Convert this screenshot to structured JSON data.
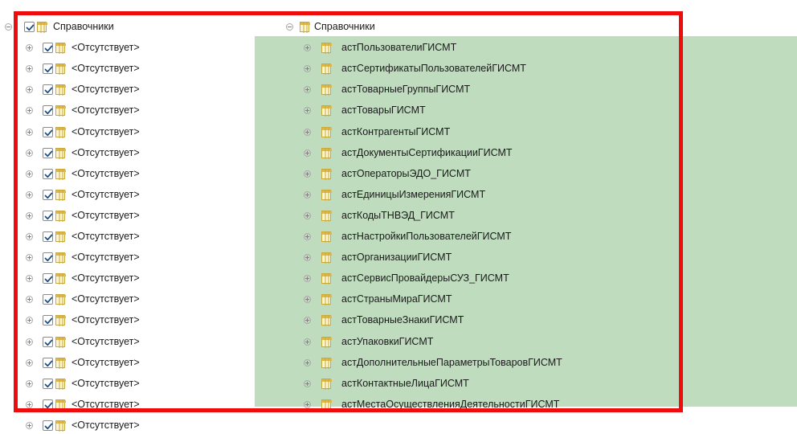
{
  "left_tree": {
    "root_label": "Справочники",
    "items": [
      {
        "label": "<Отсутствует>"
      },
      {
        "label": "<Отсутствует>"
      },
      {
        "label": "<Отсутствует>"
      },
      {
        "label": "<Отсутствует>"
      },
      {
        "label": "<Отсутствует>"
      },
      {
        "label": "<Отсутствует>"
      },
      {
        "label": "<Отсутствует>"
      },
      {
        "label": "<Отсутствует>"
      },
      {
        "label": "<Отсутствует>"
      },
      {
        "label": "<Отсутствует>"
      },
      {
        "label": "<Отсутствует>"
      },
      {
        "label": "<Отсутствует>"
      },
      {
        "label": "<Отсутствует>"
      },
      {
        "label": "<Отсутствует>"
      },
      {
        "label": "<Отсутствует>"
      },
      {
        "label": "<Отсутствует>"
      },
      {
        "label": "<Отсутствует>"
      },
      {
        "label": "<Отсутствует>"
      },
      {
        "label": "<Отсутствует>"
      }
    ]
  },
  "right_tree": {
    "root_label": "Справочники",
    "items": [
      {
        "label": "астПользователиГИСМТ"
      },
      {
        "label": "астСертификатыПользователейГИСМТ"
      },
      {
        "label": "астТоварныеГруппыГИСМТ"
      },
      {
        "label": "астТоварыГИСМТ"
      },
      {
        "label": "астКонтрагентыГИСМТ"
      },
      {
        "label": "астДокументыСертификацииГИСМТ"
      },
      {
        "label": "астОператорыЭДО_ГИСМТ"
      },
      {
        "label": "астЕдиницыИзмеренияГИСМТ"
      },
      {
        "label": "астКодыТНВЭД_ГИСМТ"
      },
      {
        "label": "астНастройкиПользователейГИСМТ"
      },
      {
        "label": "астОрганизацииГИСМТ"
      },
      {
        "label": "астСервисПровайдерыСУЗ_ГИСМТ"
      },
      {
        "label": "астСтраныМираГИСМТ"
      },
      {
        "label": "астТоварныеЗнакиГИСМТ"
      },
      {
        "label": "астУпаковкиГИСМТ"
      },
      {
        "label": "астДополнительныеПараметрыТоваровГИСМТ"
      },
      {
        "label": "астКонтактныеЛицаГИСМТ"
      },
      {
        "label": "астМестаОсуществленияДеятельностиГИСМТ"
      }
    ]
  },
  "icons": {
    "expander_expanded": "collapse-circle-icon",
    "expander_collapsed": "expand-circle-icon",
    "checkbox": "checkmark-icon",
    "table": "table-icon"
  },
  "colors": {
    "matched_rows_bg": "#bfdcbf",
    "highlight_frame": "#ee0c0c",
    "checkbox_mark": "#1c4e86",
    "table_icon_fill": "#fff6cf",
    "table_icon_border": "#c9a93a"
  }
}
